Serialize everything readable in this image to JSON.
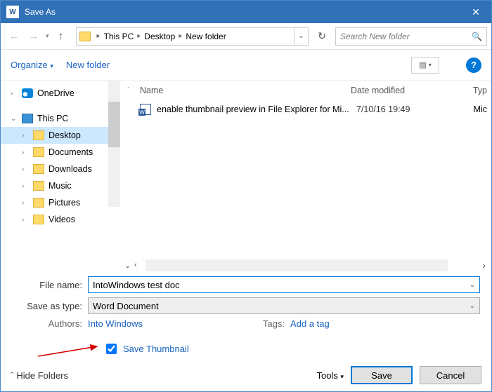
{
  "titlebar": {
    "app_glyph": "W",
    "title": "Save As",
    "close_glyph": "✕"
  },
  "nav": {
    "breadcrumb": [
      "This PC",
      "Desktop",
      "New folder"
    ],
    "refresh_glyph": "↻",
    "search_placeholder": "Search New folder",
    "search_icon": "🔍"
  },
  "toolbar": {
    "organize": "Organize",
    "new_folder": "New folder",
    "view_glyph": "▤",
    "help_glyph": "?"
  },
  "tree": {
    "onedrive": "OneDrive",
    "this_pc": "This PC",
    "desktop": "Desktop",
    "documents": "Documents",
    "downloads": "Downloads",
    "music": "Music",
    "pictures": "Pictures",
    "videos": "Videos"
  },
  "list": {
    "headers": {
      "name": "Name",
      "date": "Date modified",
      "type": "Typ"
    },
    "rows": [
      {
        "name": "enable thumbnail preview in File Explorer for Mi...",
        "date": "7/10/16 19:49",
        "type": "Mic"
      }
    ]
  },
  "form": {
    "file_name_label": "File name:",
    "file_name_value": "IntoWindows test doc",
    "save_type_label": "Save as type:",
    "save_type_value": "Word Document",
    "authors_label": "Authors:",
    "authors_value": "Into Windows",
    "tags_label": "Tags:",
    "tags_value": "Add a tag",
    "save_thumbnail": "Save Thumbnail"
  },
  "footer": {
    "hide_folders": "Hide Folders",
    "tools": "Tools",
    "save": "Save",
    "cancel": "Cancel"
  }
}
